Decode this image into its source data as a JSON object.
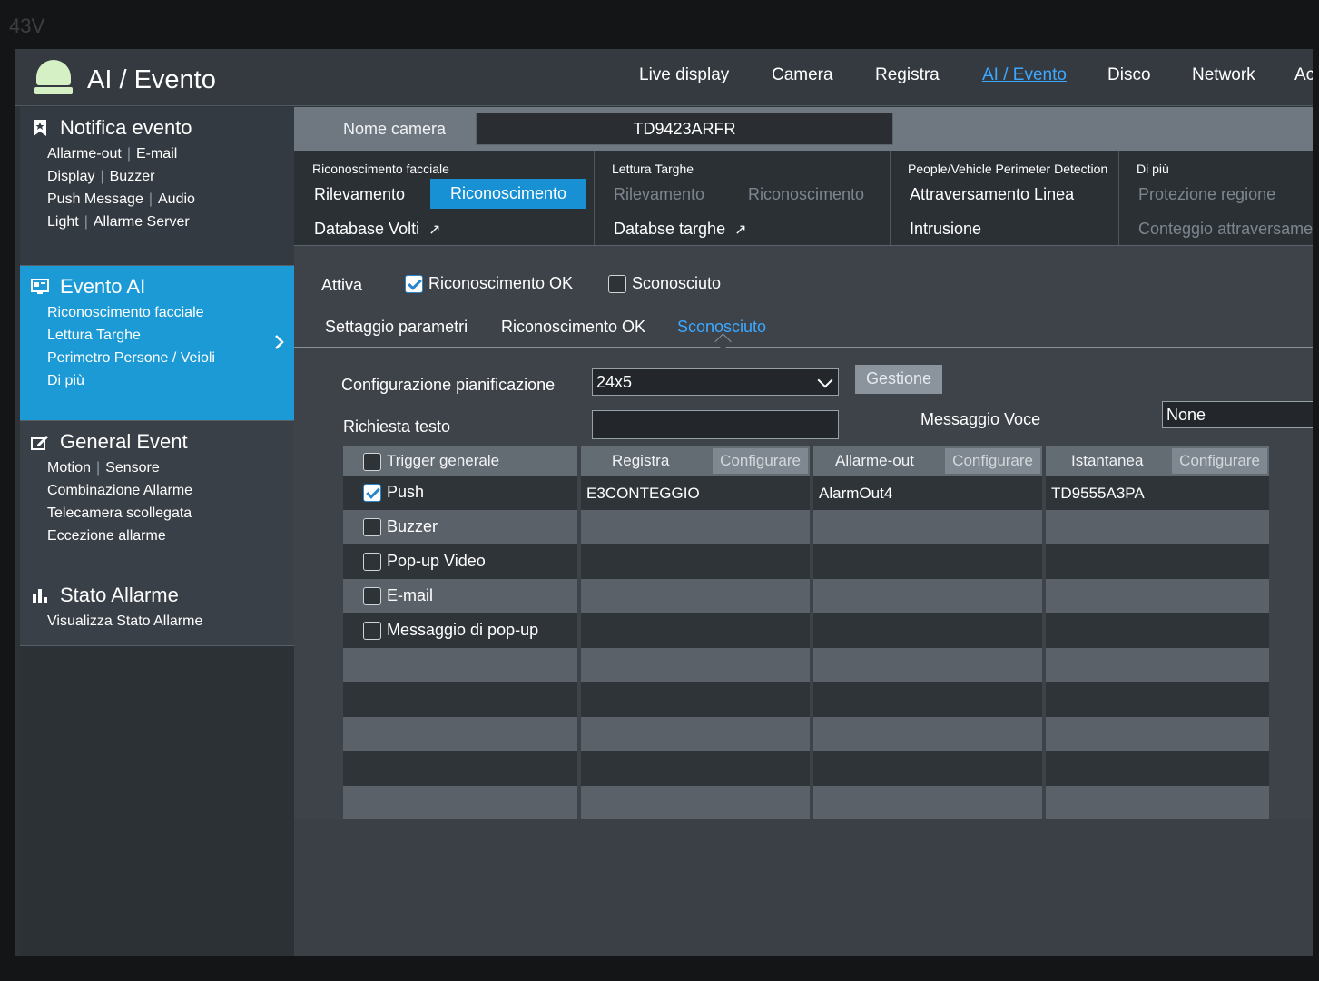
{
  "monitor_label": "43V",
  "header": {
    "title": "AI / Evento",
    "nav": [
      "Live display",
      "Camera",
      "Registra",
      "AI / Evento",
      "Disco",
      "Network",
      "Ac"
    ]
  },
  "sidebar": {
    "notifica": {
      "title": "Notifica evento",
      "lines": [
        [
          "Allarme-out",
          "E-mail"
        ],
        [
          "Display",
          "Buzzer"
        ],
        [
          "Push Message",
          "Audio"
        ],
        [
          "Light",
          "Allarme Server"
        ]
      ]
    },
    "evento_ai": {
      "title": "Evento AI",
      "items": [
        "Riconoscimento facciale",
        "Lettura Targhe",
        "Perimetro Persone / Veioli",
        "Di più"
      ]
    },
    "general": {
      "title": "General Event",
      "lines": [
        [
          "Motion",
          "Sensore"
        ],
        [
          "Combinazione Allarme"
        ],
        [
          "Telecamera scollegata"
        ],
        [
          "Eccezione allarme"
        ]
      ]
    },
    "stato": {
      "title": "Stato Allarme",
      "items": [
        "Visualizza Stato Allarme"
      ]
    }
  },
  "camera": {
    "label": "Nome camera",
    "value": "TD9423ARFR"
  },
  "tab_groups": {
    "facciale": {
      "title": "Riconoscimento facciale",
      "rilevamento": "Rilevamento",
      "riconoscimento": "Riconoscimento",
      "database": "Database Volti"
    },
    "targhe": {
      "title": "Lettura Targhe",
      "rilevamento": "Rilevamento",
      "riconoscimento": "Riconoscimento",
      "database": "Databse targhe"
    },
    "perimeter": {
      "title": "People/Vehicle Perimeter Detection",
      "linea": "Attraversamento Linea",
      "intrusione": "Intrusione"
    },
    "piu": {
      "title": "Di più",
      "protezione": "Protezione regione",
      "conteggio": "Conteggio attraversamen"
    }
  },
  "attiva": {
    "label": "Attiva",
    "ok_label": "Riconoscimento OK",
    "ok_checked": true,
    "sconosciuto_label": "Sconosciuto",
    "sconosciuto_checked": false
  },
  "subtabs": [
    "Settaggio parametri",
    "Riconoscimento OK",
    "Sconosciuto"
  ],
  "form": {
    "schedule_label": "Configurazione pianificazione",
    "schedule_value": "24x5",
    "manage_button": "Gestione",
    "text_label": "Richiesta testo",
    "text_value": "",
    "voice_label": "Messaggio Voce",
    "voice_value": "None"
  },
  "grid": {
    "trigger_header": "Trigger generale",
    "triggers": [
      {
        "label": "Push",
        "checked": true
      },
      {
        "label": "Buzzer",
        "checked": false
      },
      {
        "label": "Pop-up Video",
        "checked": false
      },
      {
        "label": "E-mail",
        "checked": false
      },
      {
        "label": "Messaggio di pop-up",
        "checked": false
      }
    ],
    "registra": {
      "header": "Registra",
      "button": "Configurare",
      "value": "E3CONTEGGIO"
    },
    "allarme": {
      "header": "Allarme-out",
      "button": "Configurare",
      "value": "AlarmOut4"
    },
    "istantanea": {
      "header": "Istantanea",
      "button": "Configurare",
      "value": "TD9555A3PA"
    }
  },
  "colors": {
    "accent": "#1c9ad6",
    "active_link": "#3ca8ff"
  }
}
